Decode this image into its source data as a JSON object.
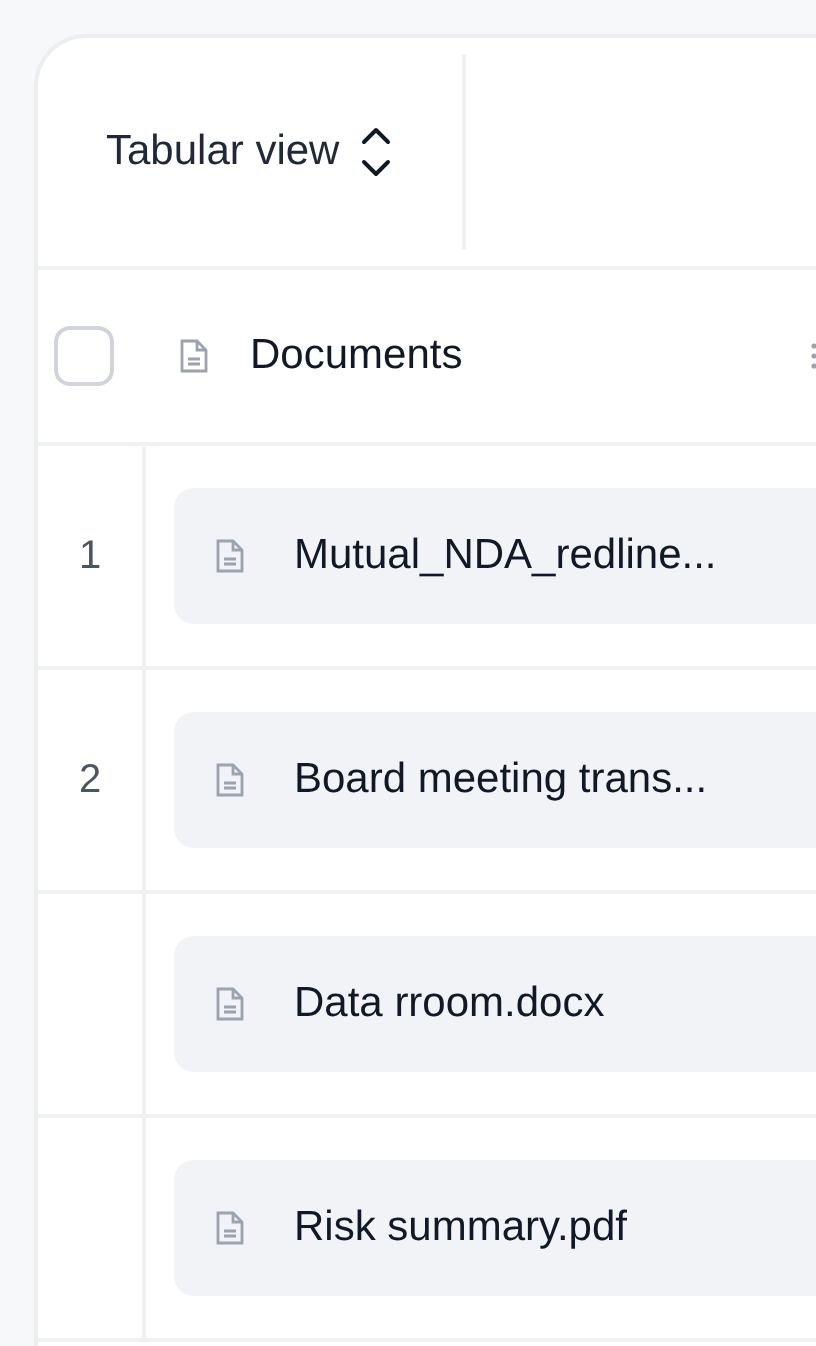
{
  "view_switcher": {
    "label": "Tabular view"
  },
  "table": {
    "select_all": {
      "checked": false
    },
    "column": {
      "label": "Documents"
    },
    "rows": [
      {
        "number": "1",
        "document": "Mutual_NDA_redline..."
      },
      {
        "number": "2",
        "document": "Board meeting trans..."
      },
      {
        "document": "Data rroom.docx"
      },
      {
        "document": "Risk summary.pdf"
      }
    ]
  }
}
